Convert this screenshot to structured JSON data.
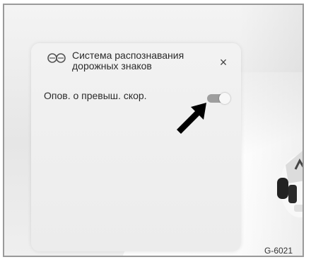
{
  "panel": {
    "title_line1": "Система распознавания",
    "title_line2": "дорожных знаков",
    "close_symbol": "×",
    "icon": "traffic-sign-recognition-icon"
  },
  "setting": {
    "label": "Опов. о превыш. скор.",
    "toggle_state": "on"
  },
  "figure_code": "G-6021",
  "colors": {
    "panel_bg": "#ececec",
    "toggle_track": "#9e9e9e",
    "arrow": "#000000"
  }
}
